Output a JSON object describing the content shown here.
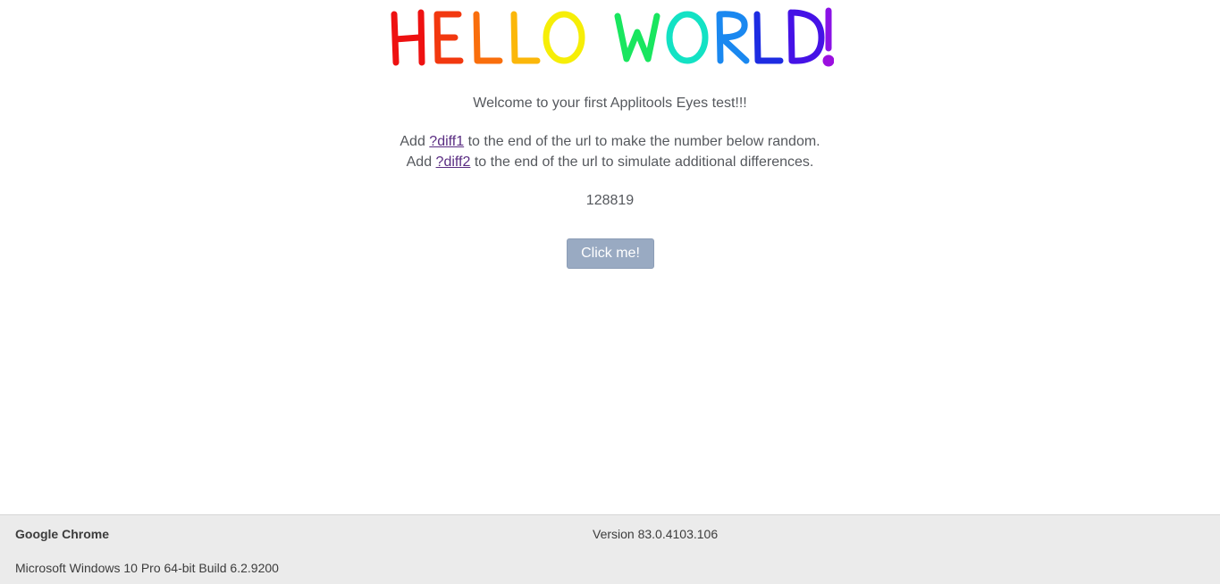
{
  "hero": {
    "logo_text": "HELLO WORLD!",
    "letter_colors": [
      "#ee1111",
      "#f2380f",
      "#f96e0c",
      "#fbb70a",
      "#f6ee07",
      "#19e65f",
      "#13e2c4",
      "#1a88f0",
      "#1d2ce2",
      "#4512e6",
      "#8a12e6",
      "#9b0fdf"
    ]
  },
  "content": {
    "welcome": "Welcome to your first Applitools Eyes test!!!",
    "line1_prefix": "Add ",
    "line1_link": "?diff1",
    "line1_suffix": " to the end of the url to make the number below random.",
    "line2_prefix": "Add ",
    "line2_link": "?diff2",
    "line2_suffix": " to the end of the url to simulate additional differences.",
    "number": "128819",
    "button_label": "Click me!"
  },
  "footer": {
    "browser": "Google Chrome",
    "version": "Version 83.0.4103.106",
    "os": "Microsoft Windows 10 Pro 64-bit Build 6.2.9200"
  }
}
